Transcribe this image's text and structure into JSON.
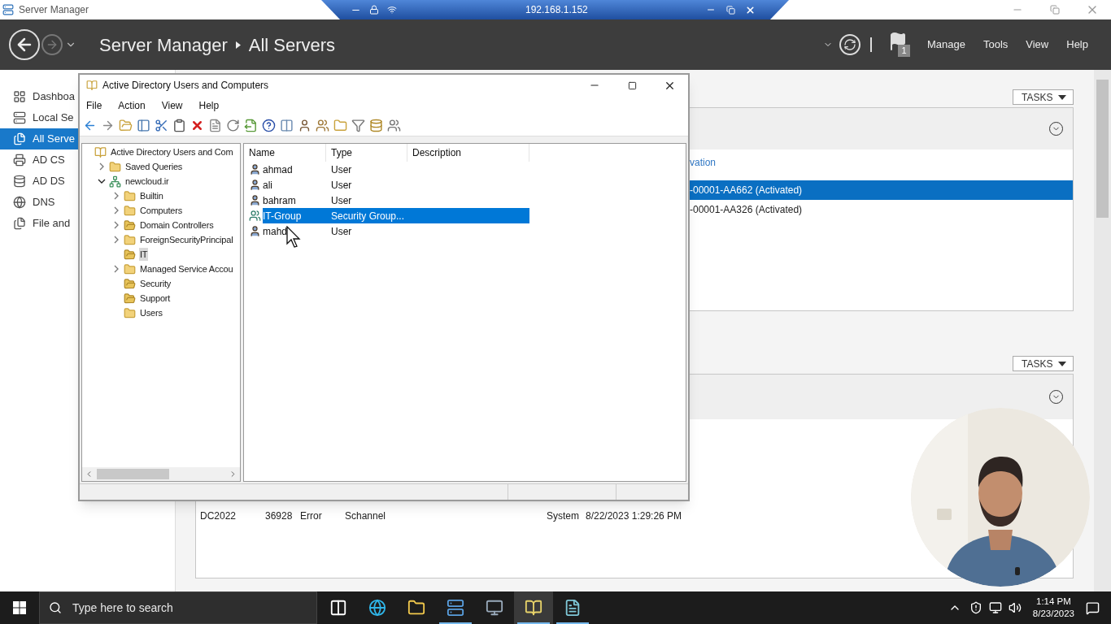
{
  "app_window": {
    "title": "Server Manager"
  },
  "remote_bar": {
    "address": "192.168.1.152"
  },
  "header": {
    "breadcrumb": [
      "Server Manager",
      "All Servers"
    ],
    "notification_count": "1",
    "menu": [
      "Manage",
      "Tools",
      "View",
      "Help"
    ]
  },
  "sidebar": {
    "items": [
      {
        "label": "Dashboa",
        "selected": false
      },
      {
        "label": "Local Se",
        "selected": false
      },
      {
        "label": "All Serve",
        "selected": true
      },
      {
        "label": "AD CS",
        "selected": false
      },
      {
        "label": "AD DS",
        "selected": false
      },
      {
        "label": "DNS",
        "selected": false
      },
      {
        "label": "File and",
        "selected": false
      }
    ]
  },
  "servers_panel": {
    "tasks": "TASKS",
    "column_1": "vation",
    "rows": [
      {
        "cells": [
          "-00001-AA662 (Activated)"
        ],
        "selected": true
      },
      {
        "cells": [
          "-00001-AA326 (Activated)"
        ],
        "selected": false
      }
    ]
  },
  "events_panel": {
    "tasks": "TASKS",
    "rows": [
      {
        "cells": [
          "DC2022",
          "36928",
          "Error",
          "Schannel",
          "System",
          "8/22/2023 1:29:26 PM"
        ],
        "selected": false
      }
    ]
  },
  "aduc_window": {
    "title": "Active Directory Users and Computers",
    "menu": [
      "File",
      "Action",
      "View",
      "Help"
    ],
    "tree": [
      {
        "label": "Active Directory Users and Com",
        "kind": "root",
        "selected": false,
        "children": [
          {
            "label": "Saved Queries",
            "kind": "folder",
            "expanded": false,
            "selected": false
          },
          {
            "label": "newcloud.ir",
            "kind": "domain",
            "expanded": true,
            "selected": false,
            "children": [
              {
                "label": "Builtin",
                "kind": "folder",
                "expanded": false,
                "selected": false
              },
              {
                "label": "Computers",
                "kind": "folder",
                "expanded": false,
                "selected": false
              },
              {
                "label": "Domain Controllers",
                "kind": "ou",
                "expanded": false,
                "selected": false
              },
              {
                "label": "ForeignSecurityPrincipal",
                "kind": "folder",
                "expanded": false,
                "selected": false
              },
              {
                "label": "IT",
                "kind": "ou",
                "selected": true
              },
              {
                "label": "Managed Service Accou",
                "kind": "folder",
                "expanded": false,
                "selected": false
              },
              {
                "label": "Security",
                "kind": "ou",
                "selected": false
              },
              {
                "label": "Support",
                "kind": "ou",
                "selected": false
              },
              {
                "label": "Users",
                "kind": "folder",
                "selected": false
              }
            ]
          }
        ]
      }
    ],
    "list": {
      "columns": [
        "Name",
        "Type",
        "Description"
      ],
      "rows": [
        {
          "name": "ahmad",
          "type": "User",
          "kind": "user",
          "selected": false
        },
        {
          "name": "ali",
          "type": "User",
          "kind": "user",
          "selected": false
        },
        {
          "name": "bahram",
          "type": "User",
          "kind": "user",
          "selected": false
        },
        {
          "name": "IT-Group",
          "type": "Security Group...",
          "kind": "group",
          "selected": true
        },
        {
          "name": "mahd",
          "type": "User",
          "kind": "user",
          "selected": false
        }
      ]
    }
  },
  "taskbar": {
    "search": {
      "placeholder": "Type here to search"
    },
    "apps": [
      {
        "open": false,
        "selected": false
      },
      {
        "open": false,
        "selected": false
      },
      {
        "open": false,
        "selected": false
      },
      {
        "open": true,
        "selected": false
      },
      {
        "open": false,
        "selected": false
      },
      {
        "open": true,
        "selected": true
      },
      {
        "open": true,
        "selected": false
      }
    ],
    "time": "1:14 PM",
    "date": "8/23/2023"
  }
}
